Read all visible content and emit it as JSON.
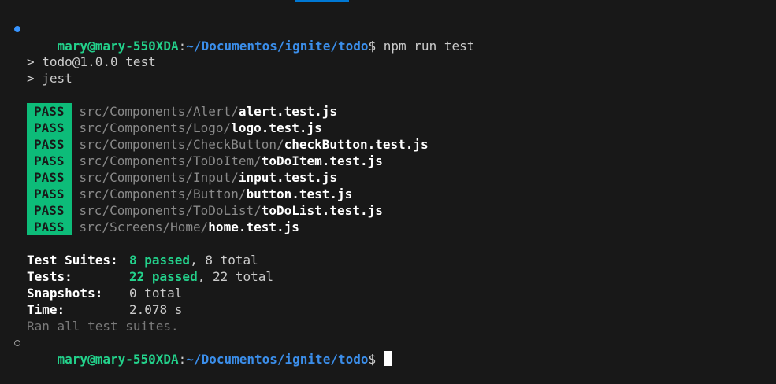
{
  "prompt": {
    "user_host": "mary@mary-550XDA",
    "colon": ":",
    "path": "~/Documentos/ignite/todo",
    "dollar": "$"
  },
  "command": "npm run test",
  "script_lines": [
    "> todo@1.0.0 test",
    "> jest"
  ],
  "tests": [
    {
      "status": "PASS",
      "dir": "src/Components/Alert/",
      "file": "alert.test.js"
    },
    {
      "status": "PASS",
      "dir": "src/Components/Logo/",
      "file": "logo.test.js"
    },
    {
      "status": "PASS",
      "dir": "src/Components/CheckButton/",
      "file": "checkButton.test.js"
    },
    {
      "status": "PASS",
      "dir": "src/Components/ToDoItem/",
      "file": "toDoItem.test.js"
    },
    {
      "status": "PASS",
      "dir": "src/Components/Input/",
      "file": "input.test.js"
    },
    {
      "status": "PASS",
      "dir": "src/Components/Button/",
      "file": "button.test.js"
    },
    {
      "status": "PASS",
      "dir": "src/Components/ToDoList/",
      "file": "toDoList.test.js"
    },
    {
      "status": "PASS",
      "dir": "src/Screens/Home/",
      "file": "home.test.js"
    }
  ],
  "summary": {
    "suites_label": "Test Suites:",
    "suites_passed": "8 passed",
    "suites_total": ", 8 total",
    "tests_label": "Tests:",
    "tests_passed": "22 passed",
    "tests_total": ", 22 total",
    "snapshots_label": "Snapshots:",
    "snapshots_value": "0 total",
    "time_label": "Time:",
    "time_value": "2.078 s",
    "ran_all": "Ran all test suites."
  },
  "colors": {
    "background": "#181818",
    "user_green": "#23d18b",
    "path_blue": "#3b8eea",
    "pass_badge": "#0dbc79",
    "decoration_blue": "#3794ff"
  }
}
